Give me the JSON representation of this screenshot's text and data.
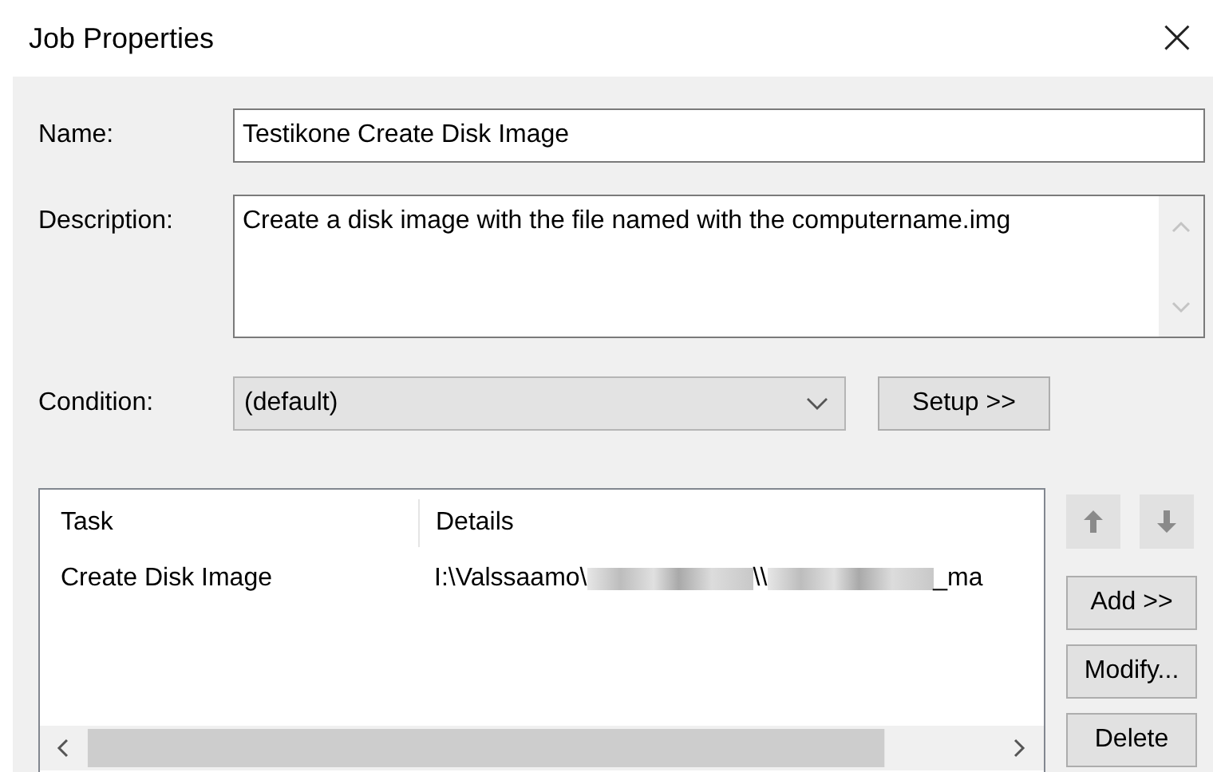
{
  "window": {
    "title": "Job Properties",
    "close": "×"
  },
  "name": {
    "label": "Name:",
    "value": "Testikone Create Disk Image"
  },
  "description": {
    "label": "Description:",
    "value": "Create a disk image with the file named with the computername.img"
  },
  "condition": {
    "label": "Condition:",
    "value": "(default)",
    "button": "Setup >>"
  },
  "tasks": {
    "columns": [
      "Task",
      "Details"
    ],
    "rows": [
      {
        "task": "Create Disk Image",
        "details": [
          {
            "kind": "text",
            "text": "I:\\Valssaamo\\"
          },
          {
            "kind": "redacted"
          },
          {
            "kind": "text",
            "text": "\\\\"
          },
          {
            "kind": "redacted"
          },
          {
            "kind": "text",
            "text": "_ma"
          }
        ]
      }
    ]
  },
  "side_buttons": [
    "Add >>",
    "Modify...",
    "Delete"
  ]
}
